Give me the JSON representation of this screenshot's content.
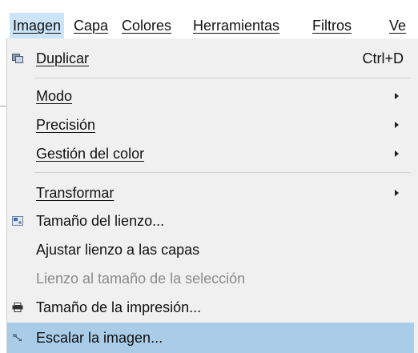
{
  "menubar": {
    "items": [
      {
        "label": "Imagen",
        "active": true
      },
      {
        "label": "Capa"
      },
      {
        "label": "Colores"
      },
      {
        "label": "Herramientas"
      },
      {
        "label": "Filtros"
      },
      {
        "label": "Ve"
      }
    ]
  },
  "menu": {
    "items": [
      {
        "label": "Duplicar",
        "shortcut": "Ctrl+D",
        "icon": "duplicate-icon"
      },
      {
        "label": "Modo",
        "submenu": true
      },
      {
        "label": "Precisión",
        "submenu": true
      },
      {
        "label": "Gestión del color",
        "submenu": true
      },
      {
        "label": "Transformar",
        "submenu": true
      },
      {
        "label": "Tamaño del lienzo...",
        "icon": "canvas-size-icon"
      },
      {
        "label": "Ajustar lienzo a las capas"
      },
      {
        "label": "Lienzo al tamaño de la selección",
        "disabled": true
      },
      {
        "label": "Tamaño de la impresión...",
        "icon": "printer-icon"
      },
      {
        "label": "Escalar la imagen...",
        "icon": "scale-image-icon",
        "highlighted": true
      }
    ]
  },
  "colors": {
    "menu_background": "#f0f0f0",
    "active_menubar": "#cce4f7",
    "highlight": "#a9cde8",
    "disabled_text": "#8a8a8a"
  }
}
